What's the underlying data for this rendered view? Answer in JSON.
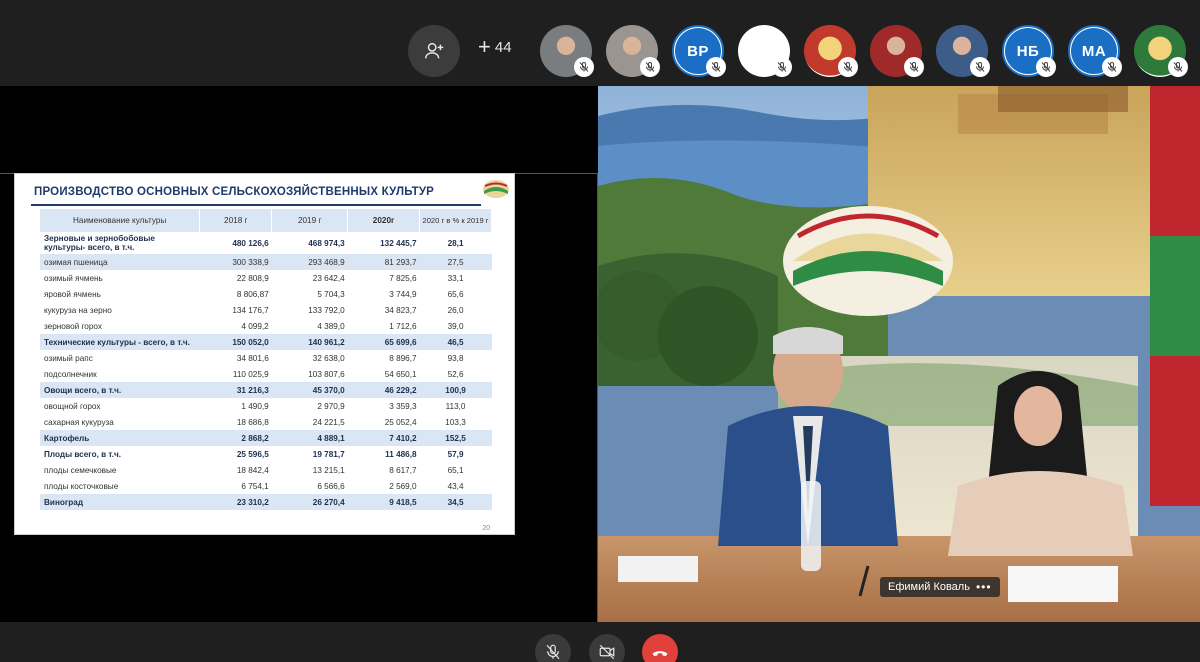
{
  "topbar": {
    "more_count": "44",
    "participants": [
      {
        "initials": "",
        "kind": "photo",
        "color": "#7a7d80"
      },
      {
        "initials": "",
        "kind": "photo",
        "color": "#9a9590"
      },
      {
        "initials": "ВР",
        "kind": "initials",
        "color": "#1a6fc4"
      },
      {
        "initials": "",
        "kind": "blank",
        "color": "#ffffff"
      },
      {
        "initials": "",
        "kind": "emblem",
        "color": "#c23a2b"
      },
      {
        "initials": "",
        "kind": "photo",
        "color": "#a02a2a"
      },
      {
        "initials": "",
        "kind": "photo",
        "color": "#3d5c88"
      },
      {
        "initials": "НБ",
        "kind": "initials",
        "color": "#1a6fc4"
      },
      {
        "initials": "МА",
        "kind": "initials",
        "color": "#1a6fc4"
      },
      {
        "initials": "",
        "kind": "emblem",
        "color": "#2d7a3a"
      }
    ]
  },
  "slide": {
    "title": "ПРОИЗВОДСТВО ОСНОВНЫХ СЕЛЬСКОХОЗЯЙСТВЕННЫХ КУЛЬТУР",
    "page_number": "20",
    "headers": [
      "Наименование культуры",
      "2018 г",
      "2019 г",
      "2020г",
      "2020 г в % к 2019 г"
    ],
    "rows": [
      {
        "name": "Зерновые и зернобобовые культуры- всего, в т.ч.",
        "v2018": "480 126,6",
        "v2019": "468 974,3",
        "v2020": "132 445,7",
        "pct": "28,1",
        "bold": true,
        "shade": false,
        "tall": true
      },
      {
        "name": "озимая пшеница",
        "v2018": "300 338,9",
        "v2019": "293 468,9",
        "v2020": "81 293,7",
        "pct": "27,5",
        "bold": false,
        "shade": true,
        "tall": false
      },
      {
        "name": "озимый ячмень",
        "v2018": "22 808,9",
        "v2019": "23 642,4",
        "v2020": "7 825,6",
        "pct": "33,1",
        "bold": false,
        "shade": false,
        "tall": false
      },
      {
        "name": "яровой ячмень",
        "v2018": "8 806,87",
        "v2019": "5 704,3",
        "v2020": "3 744,9",
        "pct": "65,6",
        "bold": false,
        "shade": false,
        "tall": false
      },
      {
        "name": "кукуруза на зерно",
        "v2018": "134 176,7",
        "v2019": "133 792,0",
        "v2020": "34 823,7",
        "pct": "26,0",
        "bold": false,
        "shade": false,
        "tall": false
      },
      {
        "name": "зерновой горох",
        "v2018": "4 099,2",
        "v2019": "4 389,0",
        "v2020": "1 712,6",
        "pct": "39,0",
        "bold": false,
        "shade": false,
        "tall": false
      },
      {
        "name": "Технические культуры - всего, в т.ч.",
        "v2018": "150 052,0",
        "v2019": "140 961,2",
        "v2020": "65 699,6",
        "pct": "46,5",
        "bold": true,
        "shade": true,
        "tall": false
      },
      {
        "name": "озимый рапс",
        "v2018": "34 801,6",
        "v2019": "32 638,0",
        "v2020": "8 896,7",
        "pct": "93,8",
        "bold": false,
        "shade": false,
        "tall": false
      },
      {
        "name": "подсолнечник",
        "v2018": "110 025,9",
        "v2019": "103 807,6",
        "v2020": "54 650,1",
        "pct": "52,6",
        "bold": false,
        "shade": false,
        "tall": false
      },
      {
        "name": "Овощи всего, в т.ч.",
        "v2018": "31 216,3",
        "v2019": "45 370,0",
        "v2020": "46 229,2",
        "pct": "100,9",
        "bold": true,
        "shade": true,
        "tall": false
      },
      {
        "name": "овощной горох",
        "v2018": "1 490,9",
        "v2019": "2 970,9",
        "v2020": "3 359,3",
        "pct": "113,0",
        "bold": false,
        "shade": false,
        "tall": false
      },
      {
        "name": "сахарная кукуруза",
        "v2018": "18 686,8",
        "v2019": "24 221,5",
        "v2020": "25 052,4",
        "pct": "103,3",
        "bold": false,
        "shade": false,
        "tall": false
      },
      {
        "name": "Картофель",
        "v2018": "2 868,2",
        "v2019": "4 889,1",
        "v2020": "7 410,2",
        "pct": "152,5",
        "bold": true,
        "shade": true,
        "tall": false
      },
      {
        "name": "Плоды всего, в т.ч.",
        "v2018": "25 596,5",
        "v2019": "19 781,7",
        "v2020": "11 486,8",
        "pct": "57,9",
        "bold": true,
        "shade": false,
        "tall": false
      },
      {
        "name": "плоды семечковые",
        "v2018": "18 842,4",
        "v2019": "13 215,1",
        "v2020": "8 617,7",
        "pct": "65,1",
        "bold": false,
        "shade": false,
        "tall": false
      },
      {
        "name": "плоды косточковые",
        "v2018": "6 754,1",
        "v2019": "6 566,6",
        "v2020": "2 569,0",
        "pct": "43,4",
        "bold": false,
        "shade": false,
        "tall": false
      },
      {
        "name": "Виноград",
        "v2018": "23 310,2",
        "v2019": "26 270,4",
        "v2020": "9 418,5",
        "pct": "34,5",
        "bold": true,
        "shade": true,
        "tall": false
      }
    ]
  },
  "video": {
    "speaker_name": "Ефимий Коваль"
  },
  "colors": {
    "accent_blue": "#1a6fc4",
    "hangup_red": "#e0413a",
    "slide_title": "#1f3b6b",
    "table_shade": "#dbe6f4"
  }
}
